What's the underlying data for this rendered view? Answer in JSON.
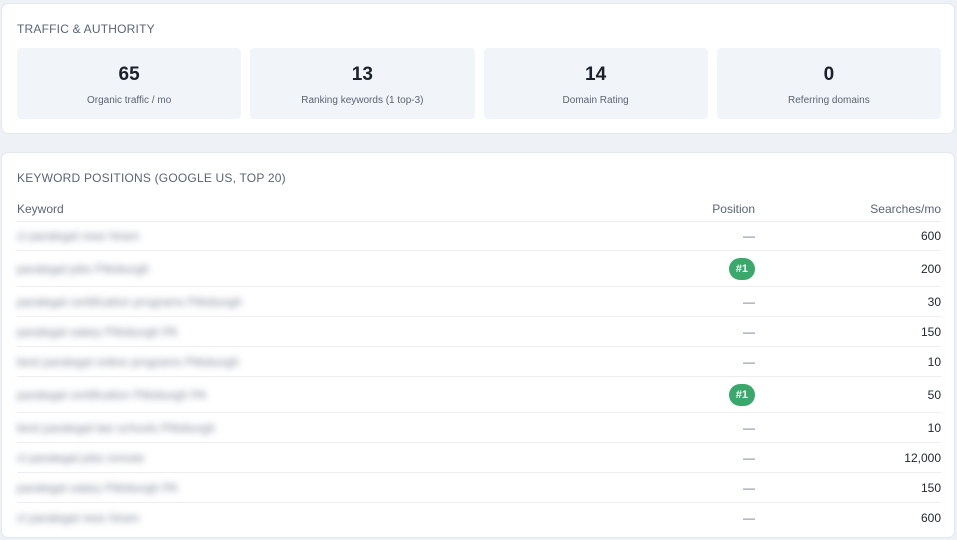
{
  "traffic": {
    "title": "TRAFFIC & AUTHORITY",
    "stats": [
      {
        "value": "65",
        "label": "Organic traffic / mo"
      },
      {
        "value": "13",
        "label": "Ranking keywords (1 top-3)"
      },
      {
        "value": "14",
        "label": "Domain Rating"
      },
      {
        "value": "0",
        "label": "Referring domains"
      }
    ]
  },
  "keywords": {
    "title": "KEYWORD POSITIONS (GOOGLE US, TOP 20)",
    "headers": {
      "keyword": "Keyword",
      "position": "Position",
      "searches": "Searches/mo"
    },
    "rows": [
      {
        "keyword": "cl paralegal near hiram",
        "position": "—",
        "searches": "600",
        "ranked": false
      },
      {
        "keyword": "paralegal jobs Pittsburgh",
        "position": "#1",
        "searches": "200",
        "ranked": true
      },
      {
        "keyword": "paralegal certification programs Pittsburgh",
        "position": "—",
        "searches": "30",
        "ranked": false
      },
      {
        "keyword": "paralegal salary Pittsburgh PA",
        "position": "—",
        "searches": "150",
        "ranked": false
      },
      {
        "keyword": "best paralegal online programs Pittsburgh",
        "position": "—",
        "searches": "10",
        "ranked": false
      },
      {
        "keyword": "paralegal certification Pittsburgh PA",
        "position": "#1",
        "searches": "50",
        "ranked": true
      },
      {
        "keyword": "best paralegal law schools Pittsburgh",
        "position": "—",
        "searches": "10",
        "ranked": false
      },
      {
        "keyword": "cl paralegal jobs remote",
        "position": "—",
        "searches": "12,000",
        "ranked": false
      },
      {
        "keyword": "paralegal salary Pittsburgh PA",
        "position": "—",
        "searches": "150",
        "ranked": false
      },
      {
        "keyword": "cl paralegal near hiram",
        "position": "—",
        "searches": "600",
        "ranked": false
      }
    ]
  },
  "colors": {
    "accent_green": "#3aa86b",
    "card_bg": "#ffffff",
    "stat_bg": "#f1f4f9",
    "page_bg": "#eef1f5"
  }
}
